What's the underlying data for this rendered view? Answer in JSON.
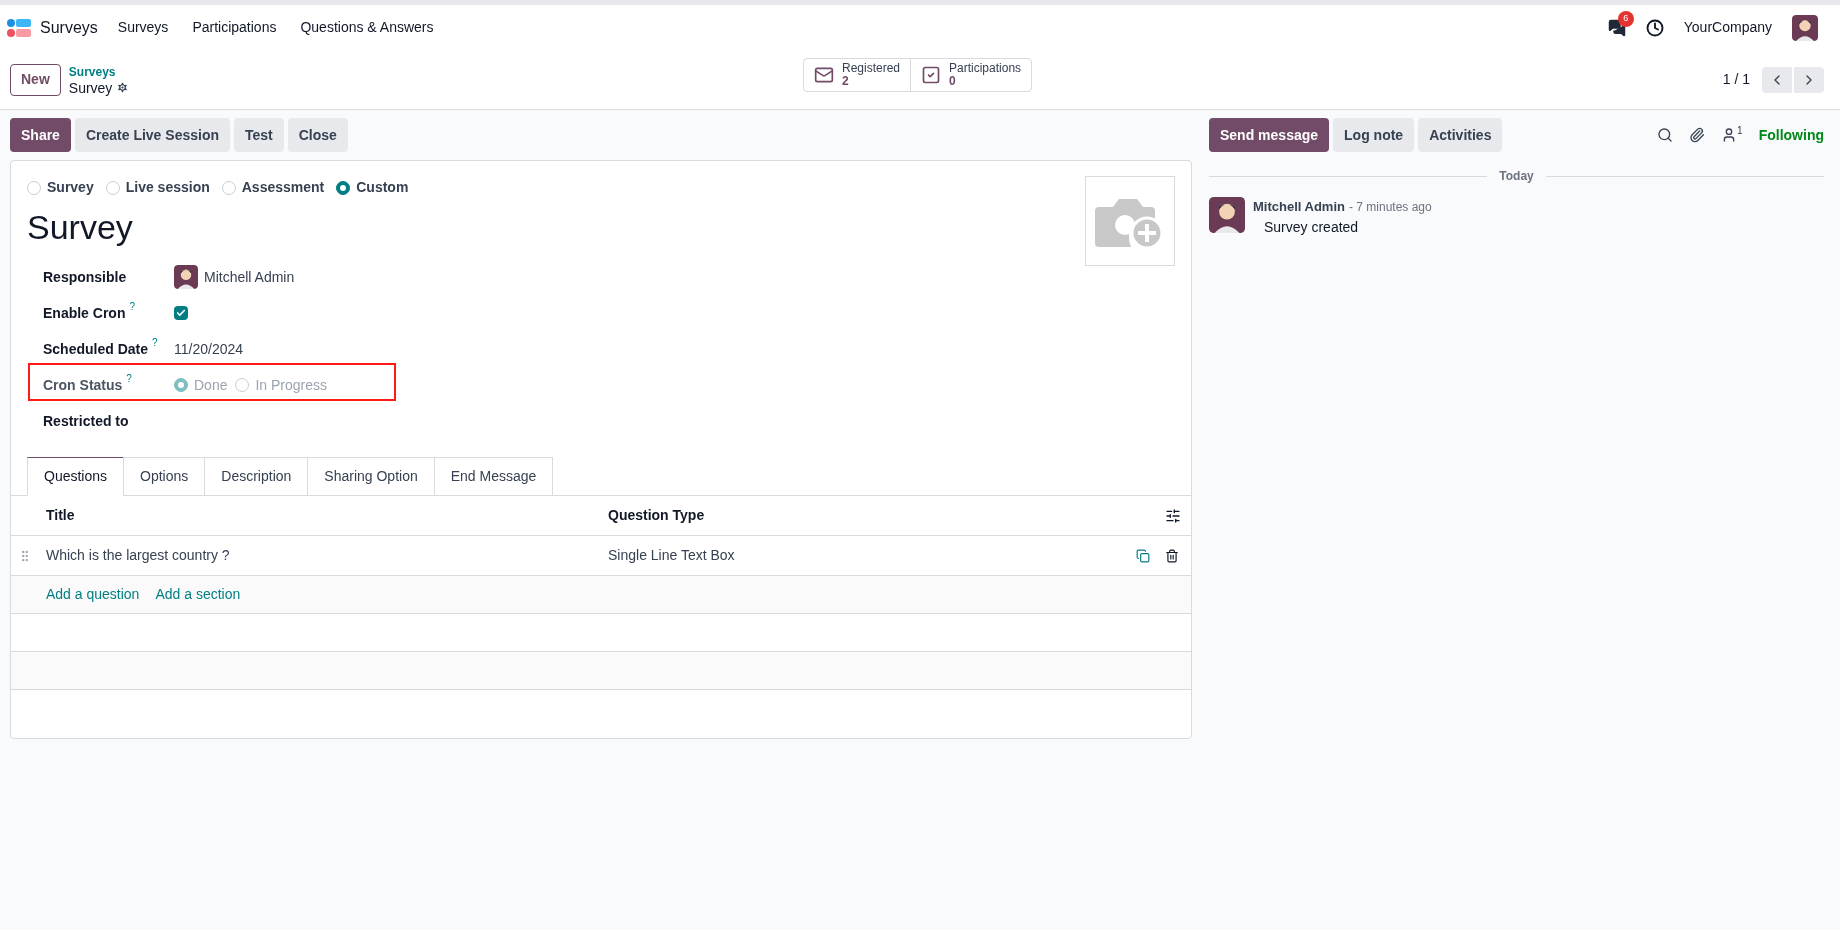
{
  "navbar": {
    "app_name": "Surveys",
    "menu": [
      "Surveys",
      "Participations",
      "Questions & Answers"
    ],
    "messages_badge": "6",
    "company": "YourCompany"
  },
  "control_panel": {
    "new_button": "New",
    "breadcrumb": {
      "parent": "Surveys",
      "current": "Survey"
    },
    "stat_buttons": [
      {
        "kind": "envelope",
        "label": "Registered",
        "value": "2"
      },
      {
        "kind": "check",
        "label": "Participations",
        "value": "0"
      }
    ],
    "pager": "1 / 1"
  },
  "actions": [
    {
      "label": "Share",
      "primary": true
    },
    {
      "label": "Create Live Session",
      "primary": false
    },
    {
      "label": "Test",
      "primary": false
    },
    {
      "label": "Close",
      "primary": false
    }
  ],
  "form": {
    "survey_types": [
      {
        "label": "Survey",
        "selected": false
      },
      {
        "label": "Live session",
        "selected": false
      },
      {
        "label": "Assessment",
        "selected": false
      },
      {
        "label": "Custom",
        "selected": true
      }
    ],
    "title": "Survey",
    "fields": [
      {
        "kind": "user",
        "label": "Responsible",
        "value": "Mitchell Admin"
      },
      {
        "kind": "checkbox",
        "label": "Enable Cron",
        "help": "?",
        "checked": true
      },
      {
        "kind": "text",
        "label": "Scheduled Date",
        "help": "?",
        "value": "11/20/2024"
      },
      {
        "kind": "radio",
        "label": "Cron Status",
        "help": "?",
        "disabled": true,
        "highlighted": true,
        "options": [
          {
            "label": "Done",
            "selected": true
          },
          {
            "label": "In Progress",
            "selected": false
          }
        ]
      },
      {
        "kind": "empty",
        "label": "Restricted to"
      }
    ],
    "tabs": [
      {
        "label": "Questions",
        "selected": true
      },
      {
        "label": "Options",
        "selected": false
      },
      {
        "label": "Description",
        "selected": false
      },
      {
        "label": "Sharing Option",
        "selected": false
      },
      {
        "label": "End Message",
        "selected": false
      }
    ],
    "table": {
      "columns": [
        "Title",
        "Question Type"
      ],
      "rows": [
        {
          "title": "Which is the largest country ?",
          "question_type": "Single Line Text Box"
        }
      ],
      "add_links": [
        "Add a question",
        "Add a section"
      ]
    }
  },
  "chatter": {
    "buttons": [
      {
        "label": "Send message",
        "primary": true
      },
      {
        "label": "Log note",
        "primary": false
      },
      {
        "label": "Activities",
        "primary": false
      }
    ],
    "follower_count": "1",
    "follow_label": "Following",
    "date_separator": "Today",
    "messages": [
      {
        "author": "Mitchell Admin",
        "time": "- 7 minutes ago",
        "body": "Survey created"
      }
    ]
  }
}
